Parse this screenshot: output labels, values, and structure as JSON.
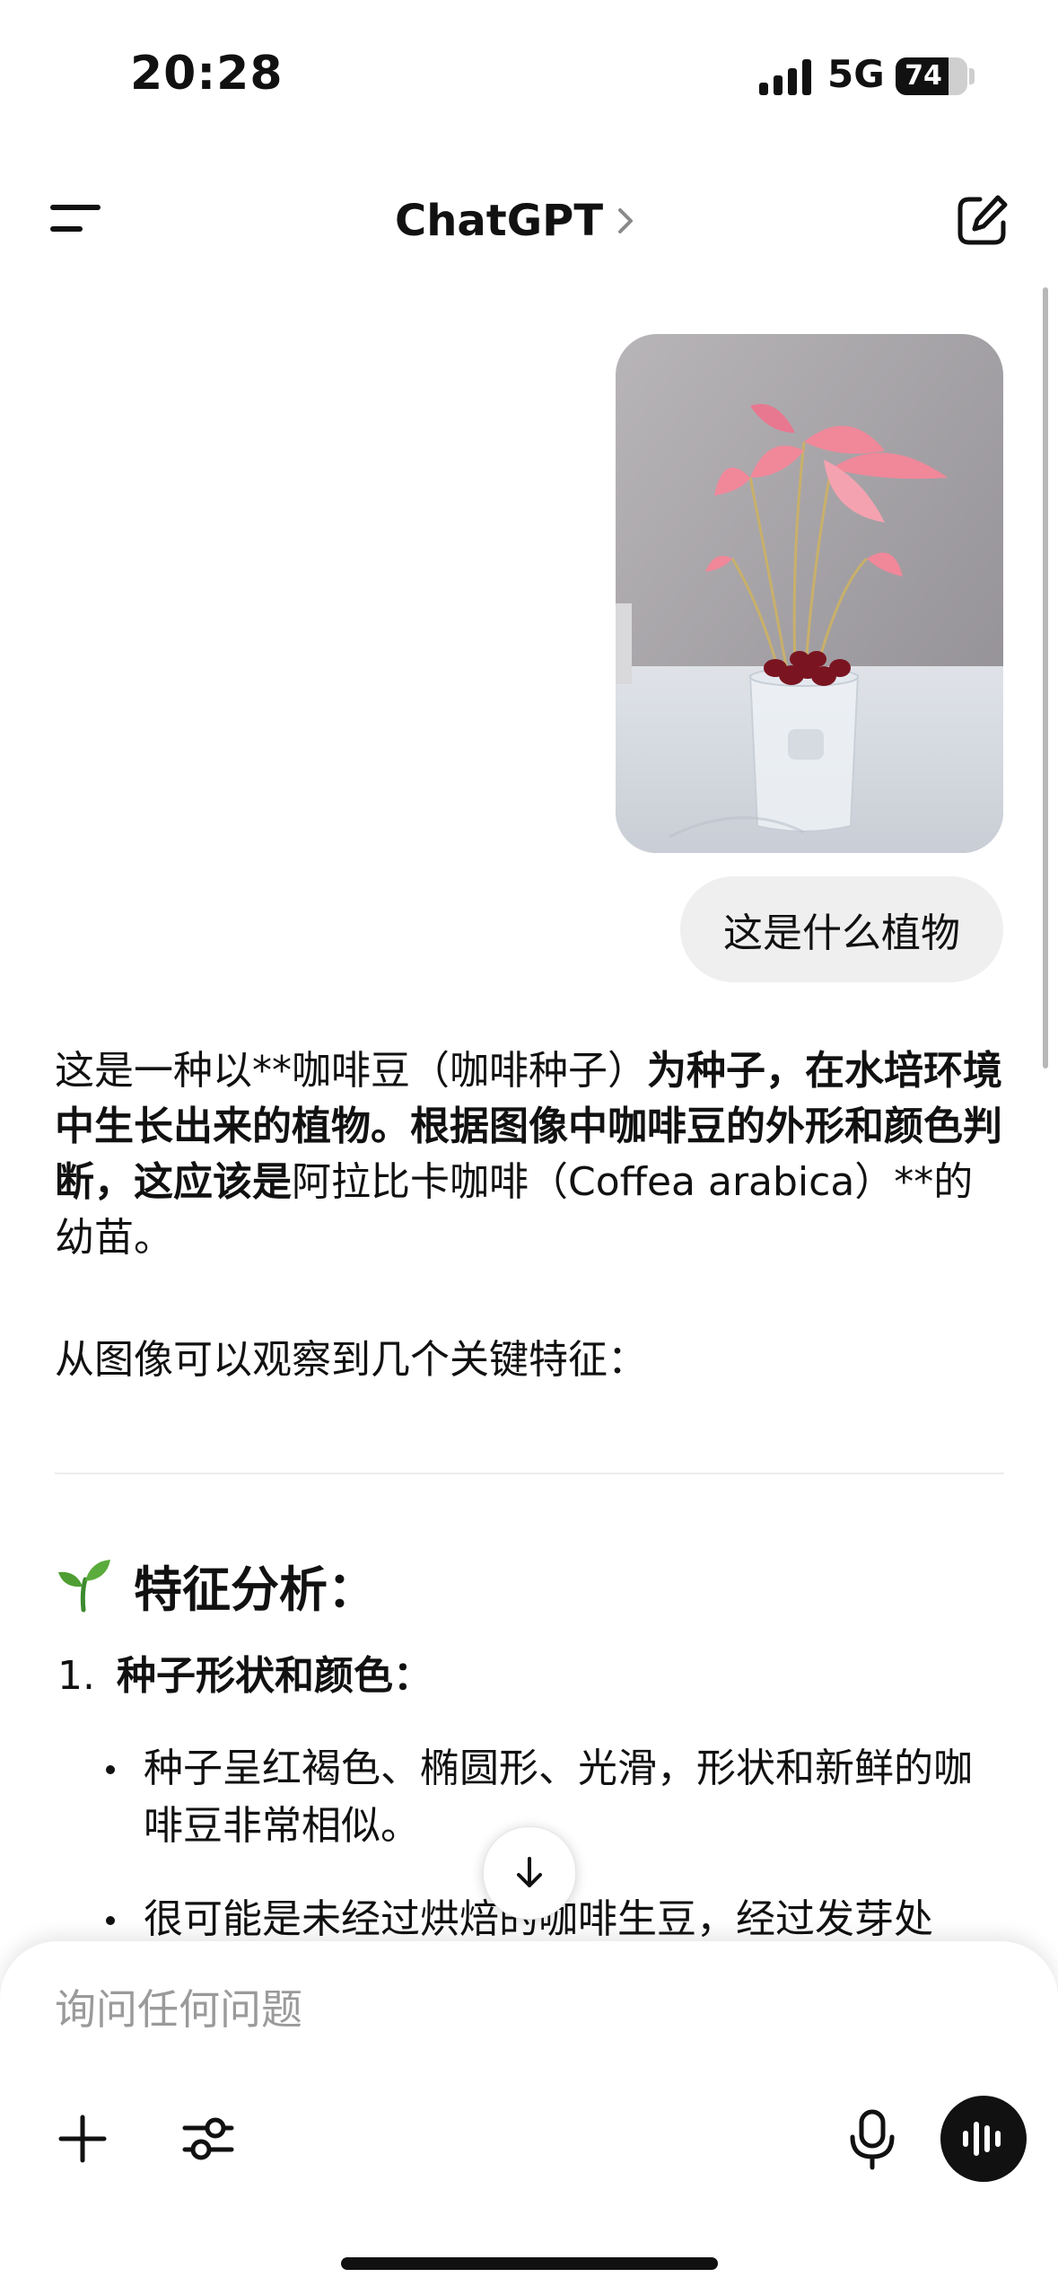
{
  "status_bar": {
    "time": "20:28",
    "network": "5G",
    "battery_level": "74",
    "battery_fraction": 0.74
  },
  "header": {
    "menu_icon": "menu-icon",
    "title": "ChatGPT",
    "title_chevron_icon": "chevron-right-icon",
    "compose_icon": "compose-icon"
  },
  "conversation": {
    "user_image_description_icon": "plant-photo",
    "user_message": "这是什么植物",
    "assistant": {
      "p1": {
        "a": "这是一种以**咖啡豆（咖啡种子）",
        "b": "为种子，在水培环境中生长出来的植物。根据图像中咖啡豆的外形和颜色判断，这应该是",
        "c": "阿拉比卡咖啡（Coffea arabica）**的幼苗。"
      },
      "p2": "从图像可以观察到几个关键特征：",
      "section_heading": "特征分析：",
      "item1": {
        "number": "1.",
        "title": "种子形状和颜色：",
        "bullets": [
          "种子呈红褐色、椭圆形、光滑，形状和新鲜的咖啡豆非常相似。",
          "很可能是未经过烘焙的咖啡生豆，经过发芽处"
        ]
      }
    }
  },
  "composer": {
    "placeholder": "询问任何问题",
    "plus_icon": "plus-icon",
    "tools_icon": "sliders-icon",
    "mic_icon": "microphone-icon",
    "voice_icon": "voice-mode-icon"
  },
  "colors": {
    "background": "#ffffff",
    "text": "#111111",
    "user_bubble": "#efefef",
    "placeholder": "#9a9a9a",
    "leaf_pink": "#f0889a"
  }
}
